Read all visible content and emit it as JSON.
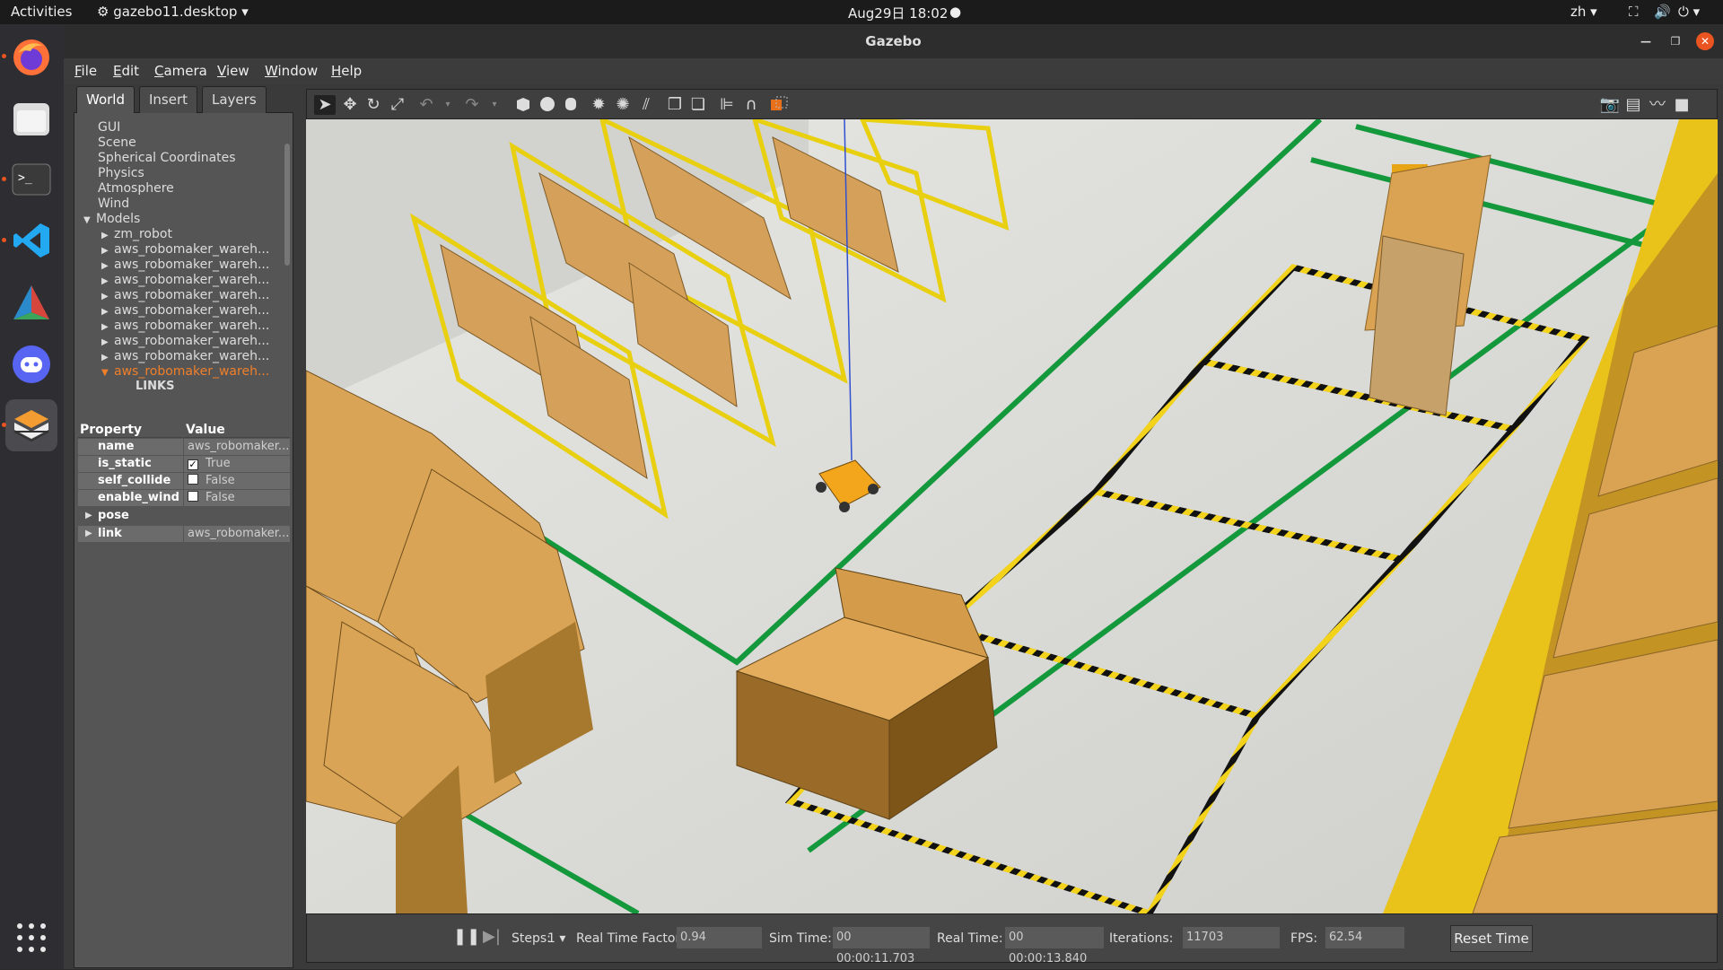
{
  "topbar": {
    "activities": "Activities",
    "app_name": "gazebo11.desktop",
    "clock": "Aug29日  18:02",
    "lang": "zh"
  },
  "window": {
    "title": "Gazebo"
  },
  "menu": [
    "File",
    "Edit",
    "Camera",
    "View",
    "Window",
    "Help"
  ],
  "left_panel": {
    "tabs": [
      "World",
      "Insert",
      "Layers"
    ],
    "active_tab": "World",
    "tree": [
      {
        "label": "GUI",
        "indent": 0
      },
      {
        "label": "Scene",
        "indent": 0
      },
      {
        "label": "Spherical Coordinates",
        "indent": 0
      },
      {
        "label": "Physics",
        "indent": 0
      },
      {
        "label": "Atmosphere",
        "indent": 0
      },
      {
        "label": "Wind",
        "indent": 0
      },
      {
        "label": "Models",
        "indent": 0
      },
      {
        "label": "zm_robot",
        "indent": 1
      },
      {
        "label": "aws_robomaker_wareh...",
        "indent": 1
      },
      {
        "label": "aws_robomaker_wareh...",
        "indent": 1
      },
      {
        "label": "aws_robomaker_wareh...",
        "indent": 1
      },
      {
        "label": "aws_robomaker_wareh...",
        "indent": 1
      },
      {
        "label": "aws_robomaker_wareh...",
        "indent": 1
      },
      {
        "label": "aws_robomaker_wareh...",
        "indent": 1
      },
      {
        "label": "aws_robomaker_wareh...",
        "indent": 1
      },
      {
        "label": "aws_robomaker_wareh...",
        "indent": 1
      },
      {
        "label": "aws_robomaker_wareh...",
        "indent": 1
      },
      {
        "label": "LINKS",
        "indent": 2
      }
    ],
    "property_header": {
      "key": "Property",
      "value": "Value"
    },
    "properties": [
      {
        "key": "name",
        "value": "aws_robomaker..."
      },
      {
        "key": "is_static",
        "value": "True",
        "checked": "✓"
      },
      {
        "key": "self_collide",
        "value": "False",
        "checked": ""
      },
      {
        "key": "enable_wind",
        "value": "False",
        "checked": ""
      },
      {
        "key": "pose",
        "value": ""
      },
      {
        "key": "link",
        "value": "aws_robomaker..."
      }
    ]
  },
  "toolbar": {
    "icons": [
      "select-arrow",
      "translate",
      "rotate",
      "scale",
      "undo",
      "redo",
      "box",
      "sphere",
      "cylinder",
      "point-light",
      "spot-light",
      "directional-light",
      "copy",
      "paste",
      "align",
      "snap",
      "view-angle",
      "screenshot",
      "log",
      "plot",
      "record"
    ]
  },
  "timebar": {
    "steps_label": "Steps:",
    "steps_value": "1",
    "rtf_label": "Real Time Factor:",
    "rtf_value": "0.94",
    "sim_label": "Sim Time:",
    "sim_value": "00 00:00:11.703",
    "real_label": "Real Time:",
    "real_value": "00 00:00:13.840",
    "iter_label": "Iterations:",
    "iter_value": "11703",
    "fps_label": "FPS:",
    "fps_value": "62.54",
    "reset_label": "Reset Time"
  }
}
